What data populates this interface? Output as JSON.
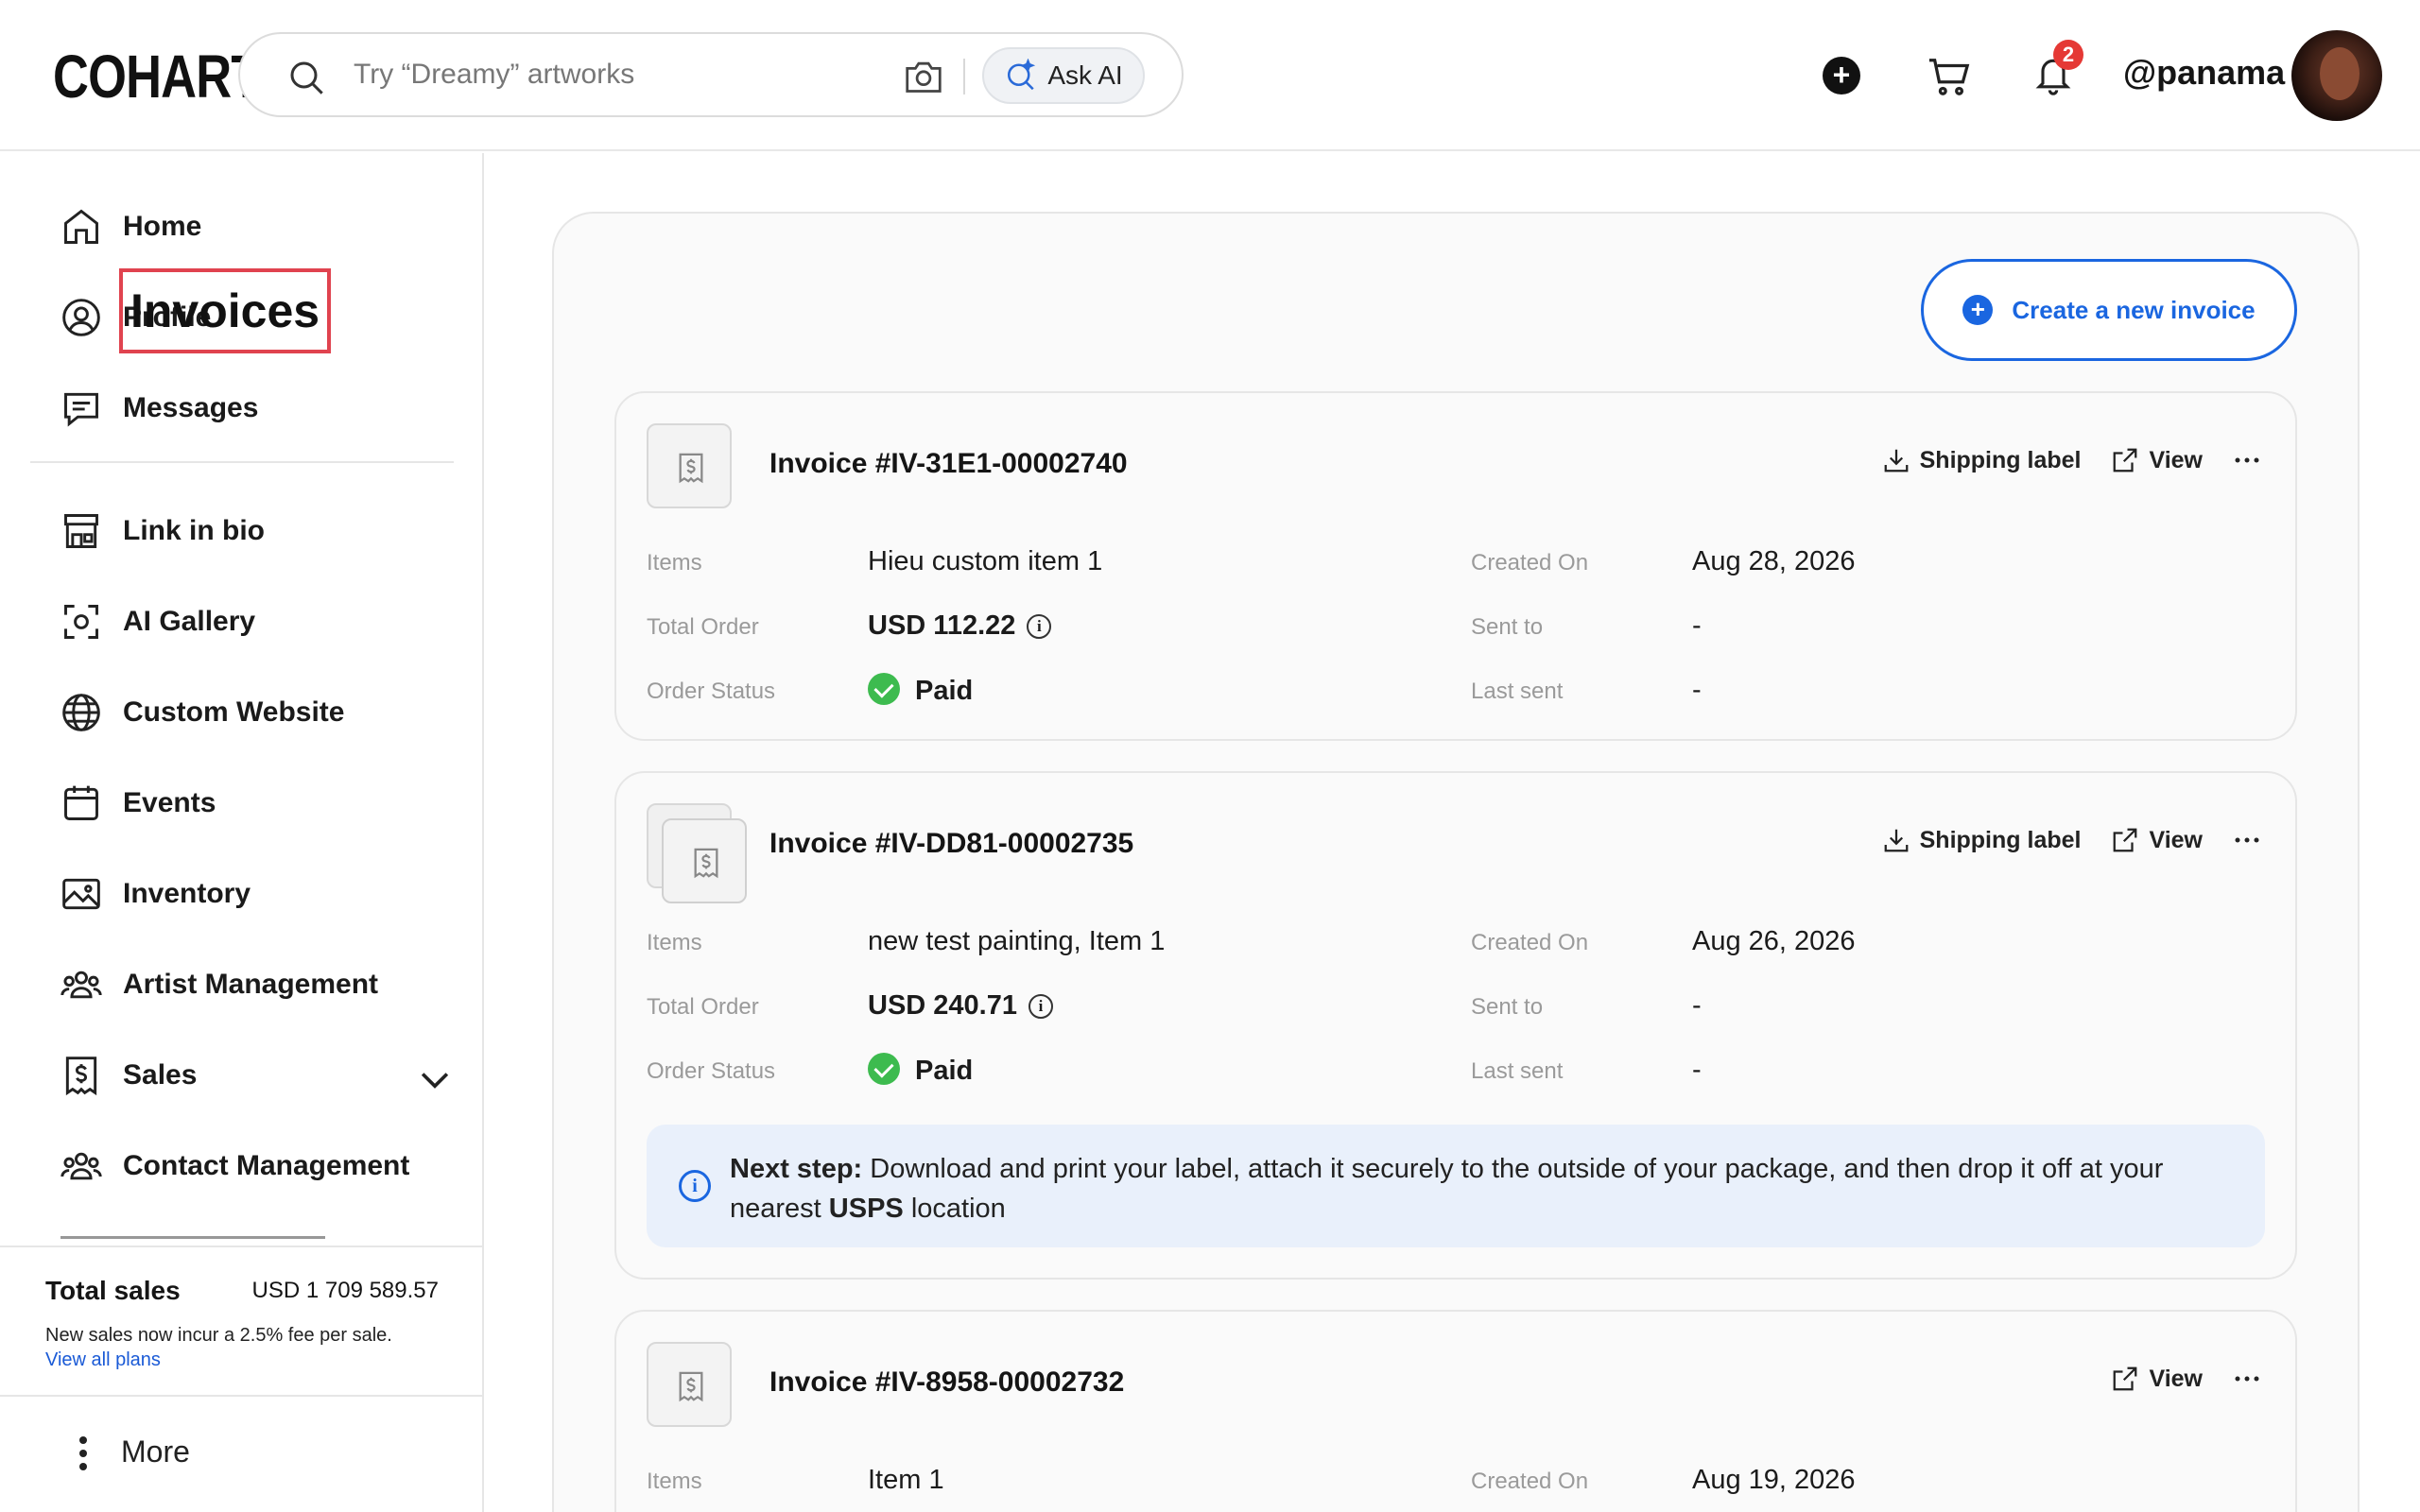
{
  "header": {
    "logo": "COHART",
    "search_placeholder": "Try “Dreamy” artworks",
    "ask_ai_label": "Ask AI",
    "notification_count": "2",
    "username": "@panama"
  },
  "sidebar": {
    "items": [
      {
        "label": "Home",
        "icon": "home-icon"
      },
      {
        "label": "Profile",
        "icon": "user-circle-icon"
      },
      {
        "label": "Messages",
        "icon": "message-icon"
      },
      {
        "label": "Link in bio",
        "icon": "storefront-icon"
      },
      {
        "label": "AI Gallery",
        "icon": "scan-face-icon"
      },
      {
        "label": "Custom Website",
        "icon": "globe-icon"
      },
      {
        "label": "Events",
        "icon": "calendar-icon"
      },
      {
        "label": "Inventory",
        "icon": "image-icon"
      },
      {
        "label": "Artist Management",
        "icon": "users-icon"
      },
      {
        "label": "Sales",
        "icon": "receipt-dollar-icon"
      },
      {
        "label": "Contact Management",
        "icon": "users-icon"
      }
    ],
    "total_sales_label": "Total sales",
    "total_sales_value": "USD 1 709 589.57",
    "fee_note": "New sales now incur a 2.5% fee per sale.",
    "view_plans_link": "View all plans",
    "more_label": "More"
  },
  "main": {
    "title": "Invoices",
    "create_button": "Create a new invoice",
    "labels": {
      "items": "Items",
      "total_order": "Total Order",
      "order_status": "Order Status",
      "created_on": "Created On",
      "sent_to": "Sent to",
      "last_sent": "Last sent",
      "shipping_label": "Shipping label",
      "view": "View"
    },
    "invoices": [
      {
        "title": "Invoice #IV-31E1-00002740",
        "items": "Hieu custom item 1",
        "total": "USD 112.22",
        "status": "Paid",
        "created_on": "Aug 28, 2026",
        "sent_to": "-",
        "last_sent": "-"
      },
      {
        "title": "Invoice #IV-DD81-00002735",
        "items": "new test painting, Item 1",
        "total": "USD 240.71",
        "status": "Paid",
        "created_on": "Aug 26, 2026",
        "sent_to": "-",
        "last_sent": "-",
        "next_step_bold": "Next step:",
        "next_step_text": " Download and print your label, attach it securely to the outside of your package, and then drop it off at your nearest ",
        "next_step_carrier": "USPS",
        "next_step_end": " location"
      },
      {
        "title": "Invoice #IV-8958-00002732",
        "items": "Item 1",
        "created_on": "Aug 19, 2026"
      }
    ]
  },
  "colors": {
    "accent": "#1a66e0",
    "paid": "#3dbb4f",
    "badge": "#e53935",
    "highlight_box": "#e0434f"
  }
}
